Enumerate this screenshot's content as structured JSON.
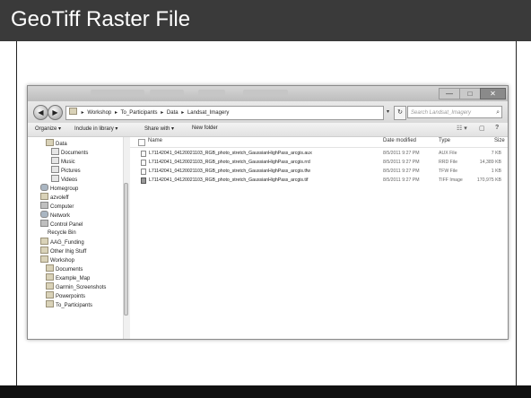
{
  "slide": {
    "title": "GeoTiff Raster File"
  },
  "window": {
    "minimize_glyph": "—",
    "maximize_glyph": "□",
    "close_glyph": "✕",
    "back_glyph": "◀",
    "forward_glyph": "▶",
    "breadcrumb": [
      "Workshop",
      "To_Participants",
      "Data",
      "Landsat_Imagery"
    ],
    "breadcrumb_sep": "▸",
    "address_dropdown": "▾",
    "refresh_glyph": "↻",
    "search_placeholder": "Search Landsat_Imagery",
    "search_icon_glyph": "⌕"
  },
  "toolbar": {
    "organize": "Organize ▾",
    "include_in_library": "Include in library ▾",
    "share_with": "Share with ▾",
    "new_folder": "New folder",
    "views_glyph": "☷ ▾",
    "preview_glyph": "▢",
    "help_glyph": "?"
  },
  "nav_pane": {
    "items": [
      {
        "label": "Data",
        "icon": "folder-icon"
      },
      {
        "label": "Documents",
        "icon": "documents-icon"
      },
      {
        "label": "Music",
        "icon": "music-icon"
      },
      {
        "label": "Pictures",
        "icon": "pictures-icon"
      },
      {
        "label": "Videos",
        "icon": "videos-icon"
      },
      {
        "label": "Homegroup",
        "icon": "homegroup-icon"
      },
      {
        "label": "azvoleff",
        "icon": "user-folder-icon"
      },
      {
        "label": "Computer",
        "icon": "computer-icon"
      },
      {
        "label": "Network",
        "icon": "network-icon"
      },
      {
        "label": "Control Panel",
        "icon": "control-panel-icon"
      },
      {
        "label": "Recycle Bin",
        "icon": ""
      },
      {
        "label": "AAG_Funding",
        "icon": "folder-icon"
      },
      {
        "label": "Other Ihig Stuff",
        "icon": "folder-icon"
      },
      {
        "label": "Workshop",
        "icon": "folder-icon"
      },
      {
        "label": "Documents",
        "icon": "folder-icon"
      },
      {
        "label": "Example_Map",
        "icon": "folder-icon"
      },
      {
        "label": "Garmin_Screenshots",
        "icon": "folder-icon"
      },
      {
        "label": "Powerpoints",
        "icon": "folder-icon"
      },
      {
        "label": "To_Participants",
        "icon": "folder-icon"
      }
    ]
  },
  "file_list": {
    "columns": {
      "name": "Name",
      "date_modified": "Date modified",
      "type": "Type",
      "size": "Size"
    },
    "rows": [
      {
        "name": "L71142041_04120021103_RGB_photo_stretch_GaussianHighPass_arcgis.aux",
        "date": "8/5/2011 9:27 PM",
        "type": "AUX File",
        "size": "7 KB",
        "icon": "file-icon"
      },
      {
        "name": "L71142041_04120021103_RGB_photo_stretch_GaussianHighPass_arcgis.rrd",
        "date": "8/5/2011 9:27 PM",
        "type": "RRD File",
        "size": "14,389 KB",
        "icon": "file-icon"
      },
      {
        "name": "L71142041_04120021103_RGB_photo_stretch_GaussianHighPass_arcgis.tfw",
        "date": "8/5/2011 9:27 PM",
        "type": "TFW File",
        "size": "1 KB",
        "icon": "file-icon"
      },
      {
        "name": "L71142041_04120021103_RGB_photo_stretch_GaussianHighPass_arcgis.tif",
        "date": "8/5/2011 9:27 PM",
        "type": "TIFF Image",
        "size": "170,975 KB",
        "icon": "tiff-image-icon"
      }
    ]
  }
}
